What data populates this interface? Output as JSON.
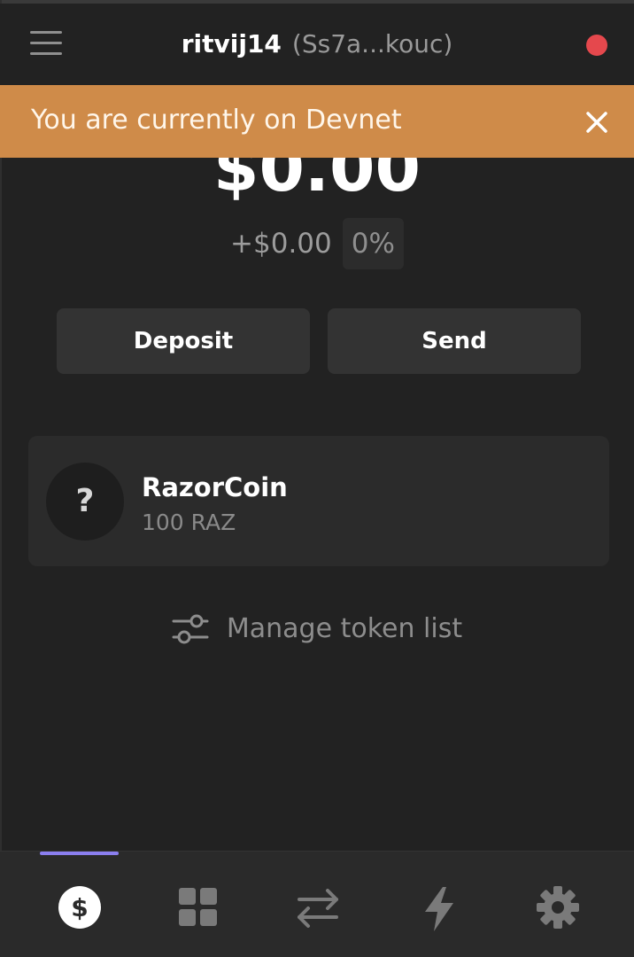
{
  "header": {
    "wallet_name": "ritvij14",
    "wallet_address": "(Ss7a...kouc)",
    "menu_icon": "hamburger-menu-icon",
    "status_dot_color": "#e5484d"
  },
  "banner": {
    "text": "You are currently on Devnet",
    "close_icon": "close-icon",
    "color": "#cf8b49"
  },
  "balance": {
    "total": "$0.00",
    "change_value": "+$0.00",
    "change_percent": "0%"
  },
  "actions": {
    "deposit_label": "Deposit",
    "send_label": "Send"
  },
  "tokens": [
    {
      "icon_glyph": "?",
      "name": "RazorCoin",
      "amount": "100 RAZ"
    }
  ],
  "manage": {
    "label": "Manage token list",
    "icon": "sliders-icon"
  },
  "bottom_nav": {
    "active_index": 0,
    "accent_color": "#8b7ff0",
    "items": [
      {
        "icon": "dollar-icon"
      },
      {
        "icon": "grid-icon"
      },
      {
        "icon": "swap-arrows-icon"
      },
      {
        "icon": "lightning-icon"
      },
      {
        "icon": "gear-icon"
      }
    ]
  }
}
